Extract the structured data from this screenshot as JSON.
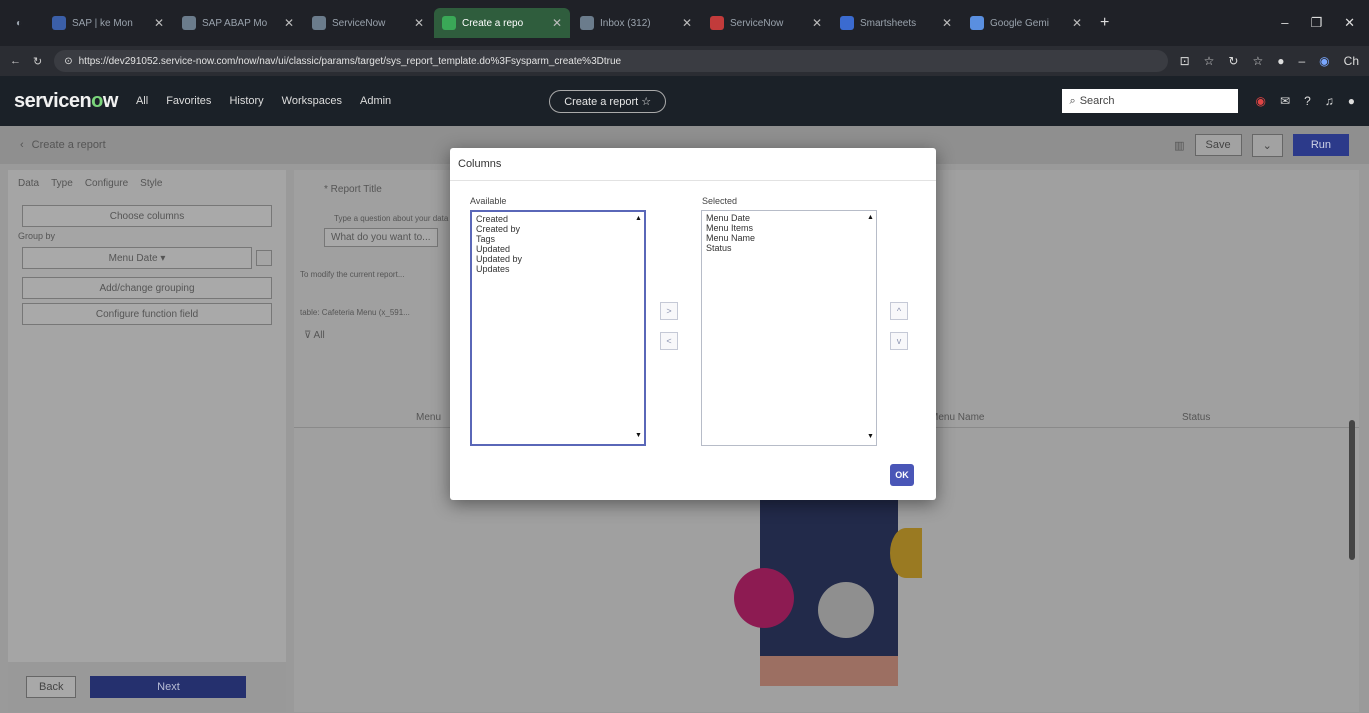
{
  "browser": {
    "tabs": [
      {
        "label": "SAP | ke Mon",
        "color": "#3b5fa8",
        "active": false
      },
      {
        "label": "SAP ABAP Mo",
        "color": "#6b7c8c",
        "active": false
      },
      {
        "label": "ServiceNow",
        "color": "#6b7c8c",
        "active": false
      },
      {
        "label": "Create a repo",
        "color": "#3aa857",
        "active": true
      },
      {
        "label": "Inbox (312)",
        "color": "#6b7c8c",
        "active": false
      },
      {
        "label": "ServiceNow",
        "color": "#c23b3b",
        "active": false
      },
      {
        "label": "Smartsheets",
        "color": "#3b6bd0",
        "active": false
      },
      {
        "label": "Google Gemi",
        "color": "#5a8fe0",
        "active": false
      }
    ],
    "new_tab": "+",
    "url": "https://dev291052.service-now.com/now/nav/ui/classic/params/target/sys_report_template.do%3Fsysparm_create%3Dtrue",
    "profile_label": "Ch"
  },
  "sn_header": {
    "logo_a": "servicen",
    "logo_o": "o",
    "logo_b": "w",
    "nav": [
      "All",
      "Favorites",
      "History",
      "Workspaces",
      "Admin"
    ],
    "context_pill": "Create a report ☆",
    "search_placeholder": "Search"
  },
  "subbar": {
    "title": "Create a report",
    "save_label": "Save",
    "run_label": "Run"
  },
  "left_pane": {
    "tabs": [
      "Data",
      "Type",
      "Configure",
      "Style"
    ],
    "choose_columns": "Choose columns",
    "group_by_label": "Group by",
    "group_by_value": "Menu Date ▾",
    "add_grouping": "Add/change grouping",
    "configure_function": "Configure function field",
    "back_label": "Back",
    "next_label": "Next"
  },
  "main_pane": {
    "report_title": "* Report Title",
    "question_label": "Type a question about your data",
    "question_placeholder": "What do you want to...",
    "modify_text": "To modify the current report...",
    "table_text": "table: Cafeteria Menu (x_591...",
    "filter_label": "All",
    "col_left": "Menu",
    "col_mid": "Menu Name",
    "col_right": "Status"
  },
  "modal": {
    "title": "Columns",
    "available_label": "Available",
    "selected_label": "Selected",
    "available": [
      "Created",
      "Created by",
      "Tags",
      "Updated",
      "Updated by",
      "Updates"
    ],
    "selected": [
      "Menu Date",
      "Menu Items",
      "Menu Name",
      "Status"
    ],
    "add_arrow": ">",
    "remove_arrow": "<",
    "up_arrow": "^",
    "down_arrow": "v",
    "ok_label": "OK"
  }
}
